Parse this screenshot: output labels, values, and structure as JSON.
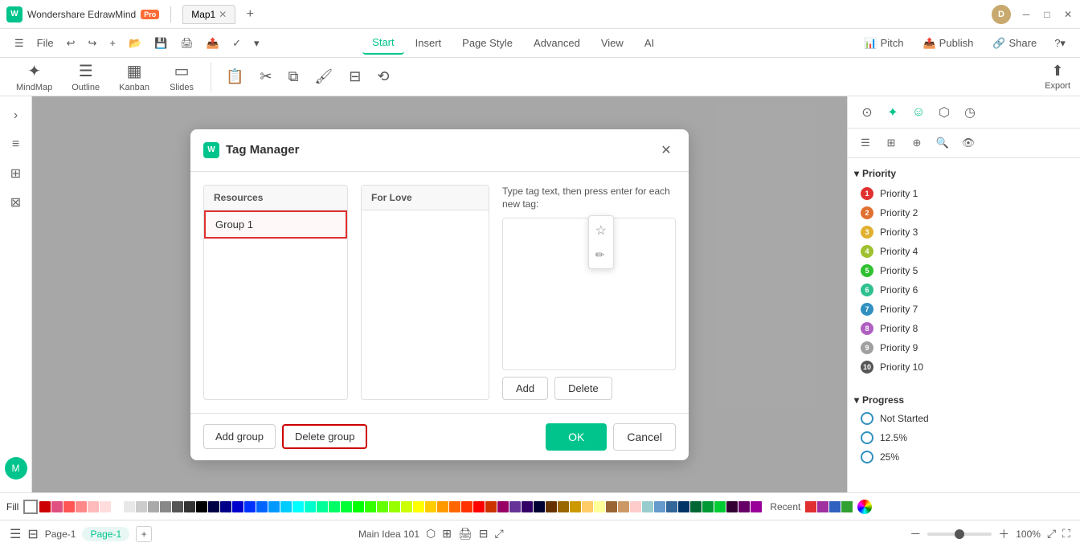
{
  "app": {
    "name": "Wondershare EdrawMind",
    "pro_badge": "Pro",
    "tab": "Map1",
    "user_initial": "D"
  },
  "menu": {
    "items": [
      "Start",
      "Insert",
      "Page Style",
      "Advanced",
      "View",
      "AI"
    ],
    "active": "Start",
    "actions": [
      {
        "label": "Pitch",
        "icon": "📊"
      },
      {
        "label": "Publish",
        "icon": "📤"
      },
      {
        "label": "Share",
        "icon": "🔗"
      }
    ]
  },
  "toolbar": {
    "tools": [
      {
        "label": "MindMap",
        "icon": "✦"
      },
      {
        "label": "Outline",
        "icon": "☰"
      },
      {
        "label": "Kanban",
        "icon": "▦"
      },
      {
        "label": "Slides",
        "icon": "▭"
      }
    ],
    "export_label": "Export"
  },
  "modal": {
    "title": "Tag Manager",
    "col1_header": "Resources",
    "group_items": [
      {
        "label": "Group 1",
        "selected": true
      }
    ],
    "col2_header": "For Love",
    "col3_label": "Type tag text, then press enter for each new tag:",
    "textarea_value": "",
    "add_btn": "Add",
    "delete_btn": "Delete",
    "add_group_btn": "Add group",
    "delete_group_btn": "Delete group",
    "ok_btn": "OK",
    "cancel_btn": "Cancel"
  },
  "right_sidebar": {
    "priority_section": "Priority",
    "priorities": [
      {
        "num": 1,
        "label": "Priority 1",
        "color": "#e03030"
      },
      {
        "num": 2,
        "label": "Priority 2",
        "color": "#e07030"
      },
      {
        "num": 3,
        "label": "Priority 3",
        "color": "#e0b030"
      },
      {
        "num": 4,
        "label": "Priority 4",
        "color": "#a0c030"
      },
      {
        "num": 5,
        "label": "Priority 5",
        "color": "#30c030"
      },
      {
        "num": 6,
        "label": "Priority 6",
        "color": "#30c090"
      },
      {
        "num": 7,
        "label": "Priority 7",
        "color": "#3090c0"
      },
      {
        "num": 8,
        "label": "Priority 8",
        "color": "#b060c0"
      },
      {
        "num": 9,
        "label": "Priority 9",
        "color": "#a0a0a0"
      },
      {
        "num": 10,
        "label": "Priority 10",
        "color": "#555555"
      }
    ],
    "progress_section": "Progress",
    "progress_items": [
      {
        "label": "Not Started",
        "color": "#3090c0"
      },
      {
        "label": "12.5%",
        "color": "#3090c0"
      },
      {
        "label": "25%",
        "color": "#3090c0"
      }
    ]
  },
  "status_bar": {
    "main_idea": "Main Idea 101",
    "page_label": "Page-1",
    "page_tab": "Page-1",
    "zoom": "100%"
  },
  "fill_label": "Fill",
  "colors": [
    "#c00",
    "#e05",
    "#f55",
    "#f88",
    "#fbb",
    "#fdd",
    "#fee",
    "#e0c0c0",
    "#fff",
    "#e8e8e8",
    "#ccc",
    "#aaa",
    "#888",
    "#555",
    "#333",
    "#111",
    "#000",
    "#004",
    "#006",
    "#008",
    "#00a",
    "#00c",
    "#03f",
    "#06f",
    "#09f",
    "#0cf",
    "#0ff",
    "#0fc",
    "#0f9",
    "#0f6",
    "#0f3",
    "#0f0",
    "#3f0",
    "#6f0",
    "#9f0",
    "#cf0",
    "#ff0",
    "#fc0",
    "#f90",
    "#f60",
    "#f30",
    "#f00",
    "#c00",
    "#900",
    "#600",
    "#300"
  ]
}
